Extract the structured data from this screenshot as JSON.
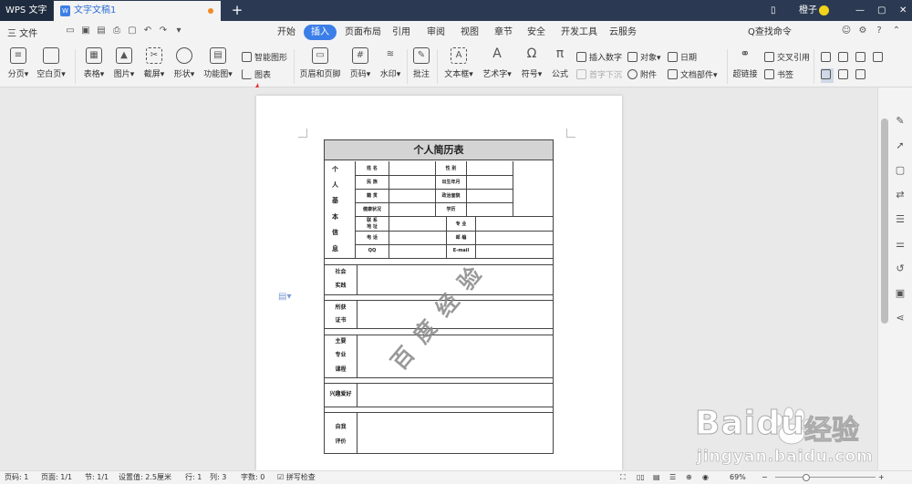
{
  "titlebar": {
    "app_name": "WPS 文字",
    "doc_tab": "文字文稿1",
    "new_tab": "+",
    "user": "橙子",
    "win_min": "—",
    "win_max": "▢",
    "win_close": "✕"
  },
  "menubar": {
    "file": "三 文件",
    "tabs": [
      "开始",
      "插入",
      "页面布局",
      "引用",
      "审阅",
      "视图",
      "章节",
      "安全",
      "开发工具",
      "云服务"
    ],
    "active_tab": "插入",
    "search": "Q查找命令"
  },
  "toolbar": {
    "page_break": "分页",
    "blank_page": "空白页",
    "table": "表格",
    "picture": "图片",
    "screenshot": "截屏",
    "shape": "形状",
    "function_chart": "功能图",
    "smart_art": "智能图形",
    "chart": "图表",
    "header_footer": "页眉和页脚",
    "page_number": "页码",
    "watermark": "水印",
    "comment": "批注",
    "textbox": "文本框",
    "wordart": "艺术字",
    "symbol": "符号",
    "formula": "公式",
    "insert_number": "插入数字",
    "first_drop": "首字下沉",
    "object": "对象",
    "attachment": "附件",
    "date": "日期",
    "doc_parts": "文档部件",
    "hyperlink": "超链接",
    "cross_ref": "交叉引用",
    "bookmark": "书签"
  },
  "resume": {
    "title": "个人简历表",
    "basic_info": [
      "个",
      "人",
      "基",
      "本",
      "信",
      "息"
    ],
    "name": "姓  名",
    "gender": "性  别",
    "ethnicity": "民  族",
    "birth": "出生年月",
    "origin": "籍  贯",
    "politics": "政治面貌",
    "health": "健康状况",
    "education": "学历",
    "address_1": "联  系",
    "address_2": "地  址",
    "major": "专  业",
    "phone": "电  话",
    "postcode": "邮  编",
    "qq": "QQ",
    "email": "E-mail",
    "social_1": "社会",
    "social_2": "实践",
    "cert_1": "所获",
    "cert_2": "证书",
    "course_1": "主要",
    "course_2": "专业",
    "course_3": "课程",
    "hobby": "兴趣爱好",
    "self_1": "自我",
    "self_2": "评价",
    "watermark": "百度经验"
  },
  "statusbar": {
    "page_no": "页码: 1",
    "pages": "页面: 1/1",
    "section": "节: 1/1",
    "setting": "设置值: 2.5厘米",
    "row": "行: 1",
    "col": "列: 3",
    "words": "字数: 0",
    "spell": "拼写检查",
    "zoom": "69%",
    "zoom_minus": "−",
    "zoom_plus": "+"
  },
  "brand": {
    "text_1": "Baidu",
    "text_2": "经验",
    "url": "jingyan.baidu.com"
  },
  "colors": {
    "accent": "#3c7ee8",
    "titlebar": "#2b3a52",
    "arrow": "#e8312f"
  }
}
